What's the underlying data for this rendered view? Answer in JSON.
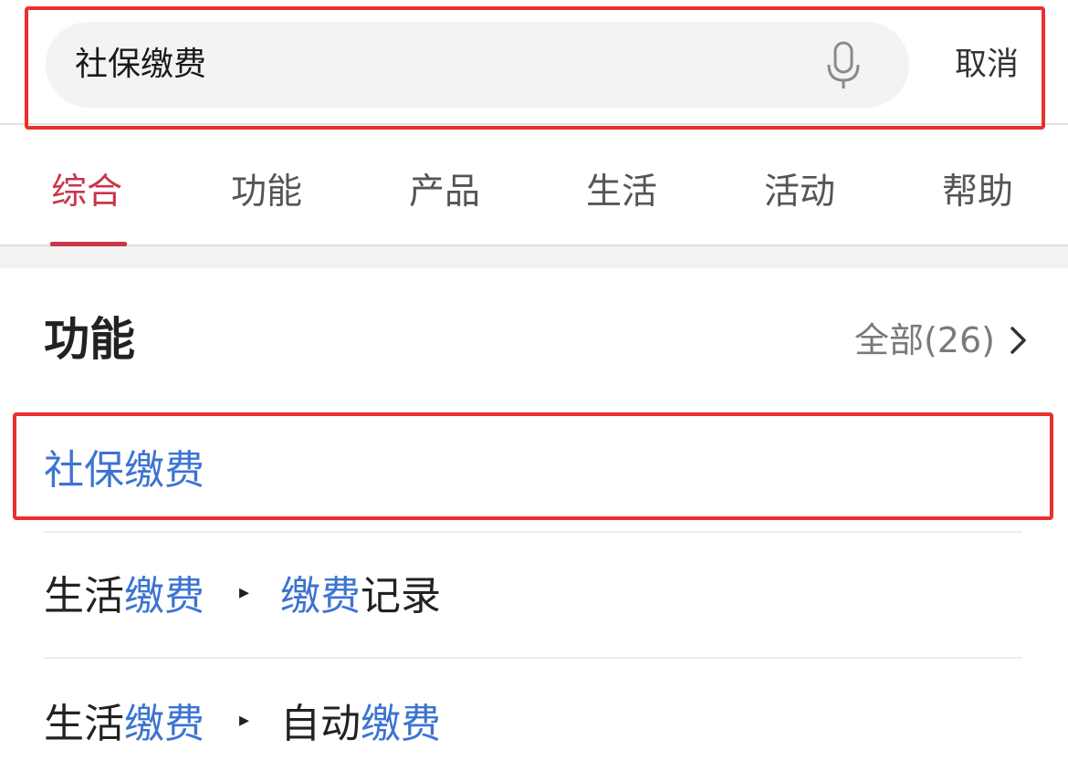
{
  "search": {
    "value": "社保缴费",
    "mic_icon": "microphone-icon",
    "cancel_label": "取消"
  },
  "tabs": [
    {
      "label": "综合",
      "active": true
    },
    {
      "label": "功能",
      "active": false
    },
    {
      "label": "产品",
      "active": false
    },
    {
      "label": "生活",
      "active": false
    },
    {
      "label": "活动",
      "active": false
    },
    {
      "label": "帮助",
      "active": false
    }
  ],
  "section": {
    "title": "功能",
    "see_all": "全部(26)",
    "see_all_icon": "chevron-right-icon"
  },
  "results": [
    {
      "parts": [
        {
          "text": "社保缴费",
          "highlight": true
        }
      ]
    },
    {
      "category": [
        {
          "text": "生活",
          "highlight": false
        },
        {
          "text": "缴费",
          "highlight": true
        }
      ],
      "item": [
        {
          "text": "缴费",
          "highlight": true
        },
        {
          "text": "记录",
          "highlight": false
        }
      ]
    },
    {
      "category": [
        {
          "text": "生活",
          "highlight": false
        },
        {
          "text": "缴费",
          "highlight": true
        }
      ],
      "item": [
        {
          "text": "自动",
          "highlight": false
        },
        {
          "text": "缴费",
          "highlight": true
        }
      ]
    }
  ],
  "breadcrumb_arrow": "▸",
  "colors": {
    "accent": "#c8364a",
    "keyword_highlight": "#3c74d1",
    "annotation_box": "#e9302d"
  }
}
